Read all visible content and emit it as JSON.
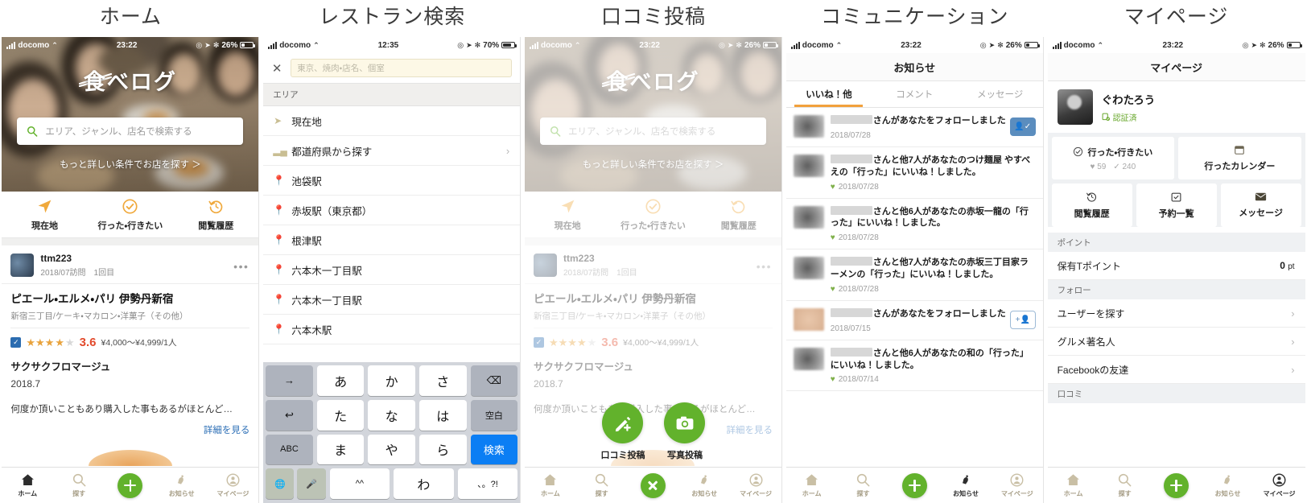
{
  "columns": [
    {
      "title": "ホーム"
    },
    {
      "title": "レストラン検索"
    },
    {
      "title": "口コミ投稿"
    },
    {
      "title": "コミュニケーション"
    },
    {
      "title": "マイページ"
    }
  ],
  "status_bars": [
    {
      "carrier": "docomo",
      "time": "23:22",
      "battery": "26%"
    },
    {
      "carrier": "docomo",
      "time": "12:35",
      "battery": "70%"
    },
    {
      "carrier": "docomo",
      "time": "23:22",
      "battery": "26%"
    },
    {
      "carrier": "docomo",
      "time": "23:22",
      "battery": "26%"
    },
    {
      "carrier": "docomo",
      "time": "23:22",
      "battery": "26%"
    }
  ],
  "home": {
    "logo": "食べログ",
    "search_placeholder": "エリア、ジャンル、店名で検索する",
    "more_link": "もっと詳しい条件でお店を探す ＞",
    "quick": [
      {
        "label": "現在地",
        "icon": "location-arrow-icon"
      },
      {
        "label": "行った・行きたい",
        "icon": "check-circle-icon"
      },
      {
        "label": "閲覧履歴",
        "icon": "history-icon"
      }
    ],
    "review": {
      "user": "ttm223",
      "visit": "2018/07訪問　1回目",
      "shop_name": "ピエール・エルメ・パリ 伊勢丹新宿",
      "shop_genre": "新宿三丁目/ケーキ・マカロン・洋菓子（その他）",
      "score": "3.6",
      "stars_filled": 3,
      "stars_half": 1,
      "budget": "¥4,000〜¥4,999/1人",
      "title": "サクサクフロマージュ",
      "date": "2018.7",
      "body": "何度か頂いこともあり購入した事もあるがほとんど…",
      "detail_link": "詳細を見る"
    }
  },
  "tabbar": [
    {
      "label": "ホーム",
      "icon": "home-icon"
    },
    {
      "label": "探す",
      "icon": "search-icon"
    },
    {
      "label": "",
      "icon": "plus-fab-icon"
    },
    {
      "label": "お知らせ",
      "icon": "bell-icon"
    },
    {
      "label": "マイページ",
      "icon": "person-circle-icon"
    }
  ],
  "search_screen": {
    "close_label": "✕",
    "input_placeholder": "東京、焼肉・店名、個室",
    "section": "エリア",
    "rows": [
      {
        "label": "現在地",
        "icon": "location-arrow-icon",
        "chevron": false
      },
      {
        "label": "都道府県から探す",
        "icon": "bars-icon",
        "chevron": true
      },
      {
        "label": "池袋駅",
        "icon": "pin-icon",
        "chevron": false
      },
      {
        "label": "赤坂駅（東京都）",
        "icon": "pin-icon",
        "chevron": false
      },
      {
        "label": "根津駅",
        "icon": "pin-icon",
        "chevron": false
      },
      {
        "label": "六本木一丁目駅",
        "icon": "pin-icon",
        "chevron": false
      },
      {
        "label": "六本木一丁目駅",
        "icon": "pin-icon",
        "chevron": false
      },
      {
        "label": "六本木駅",
        "icon": "pin-icon",
        "chevron": false
      }
    ],
    "keyboard": [
      [
        "→",
        "あ",
        "か",
        "さ",
        "⌫"
      ],
      [
        "↩",
        "た",
        "な",
        "は",
        "空白"
      ],
      [
        "ABC",
        "ま",
        "や",
        "ら",
        "検索"
      ],
      [
        "🌐",
        "🎤",
        "^^",
        "わ",
        "、。?!"
      ]
    ]
  },
  "post_screen": {
    "actions": [
      {
        "label": "口コミ投稿",
        "icon": "pencil-plus-icon"
      },
      {
        "label": "写真投稿",
        "icon": "camera-icon"
      }
    ]
  },
  "notif_screen": {
    "title": "お知らせ",
    "tabs": [
      {
        "label": "いいね！他",
        "selected": true
      },
      {
        "label": "コメント",
        "selected": false
      },
      {
        "label": "メッセージ",
        "selected": false
      }
    ],
    "items": [
      {
        "text": "さんがあなたをフォローしました",
        "date": "2018/07/28",
        "button": "filled",
        "button_icon": "person-check-icon",
        "has_like_icon": false,
        "avatar": "blur"
      },
      {
        "text": "さんと他7人があなたのつけ麺屋 やすべえの「行った」にいいね！しました。",
        "date": "2018/07/28",
        "button": null,
        "has_like_icon": true,
        "avatar": "blur"
      },
      {
        "text": "さんと他6人があなたの赤坂一龍の「行った」にいいね！しました。",
        "date": "2018/07/28",
        "button": null,
        "has_like_icon": true,
        "avatar": "blur"
      },
      {
        "text": "さんと他7人があなたの赤坂三丁目家ラーメンの「行った」にいいね！しました。",
        "date": "2018/07/28",
        "button": null,
        "has_like_icon": true,
        "avatar": "blur"
      },
      {
        "text": "さんがあなたをフォローしました",
        "date": "2018/07/15",
        "button": "outline",
        "button_icon": "person-plus-icon",
        "has_like_icon": false,
        "avatar": "skin"
      },
      {
        "text": "さんと他6人があなたの和の「行った」にいいね！しました。",
        "date": "2018/07/14",
        "button": null,
        "has_like_icon": true,
        "avatar": "blur"
      }
    ]
  },
  "mypage": {
    "title": "マイページ",
    "user_name": "ぐわたろう",
    "verified_label": "認証済",
    "card_been": {
      "label": "行った・行きたい",
      "icon": "check-circle-icon",
      "heart_count": "59",
      "check_count": "240"
    },
    "card_calendar": {
      "label": "行ったカレンダー",
      "icon": "calendar-icon"
    },
    "tiles": [
      {
        "label": "閲覧履歴",
        "icon": "history-icon"
      },
      {
        "label": "予約一覧",
        "icon": "calendar-check-icon"
      },
      {
        "label": "メッセージ",
        "icon": "envelope-icon"
      }
    ],
    "sections": [
      {
        "heading": "ポイント",
        "rows": [
          {
            "label": "保有Tポイント",
            "value": "0",
            "unit": "pt",
            "chevron": false
          }
        ]
      },
      {
        "heading": "フォロー",
        "rows": [
          {
            "label": "ユーザーを探す",
            "value": null,
            "chevron": true
          },
          {
            "label": "グルメ著名人",
            "value": null,
            "chevron": true
          },
          {
            "label": "Facebookの友達",
            "value": null,
            "chevron": true
          }
        ]
      },
      {
        "heading": "口コミ",
        "rows": []
      }
    ]
  },
  "colors": {
    "brand_green": "#62b22c",
    "accent_orange": "#f2a13c",
    "score_red": "#e24a2c",
    "link_blue": "#2a6db5",
    "keyboard_blue": "#0b7ef4"
  }
}
